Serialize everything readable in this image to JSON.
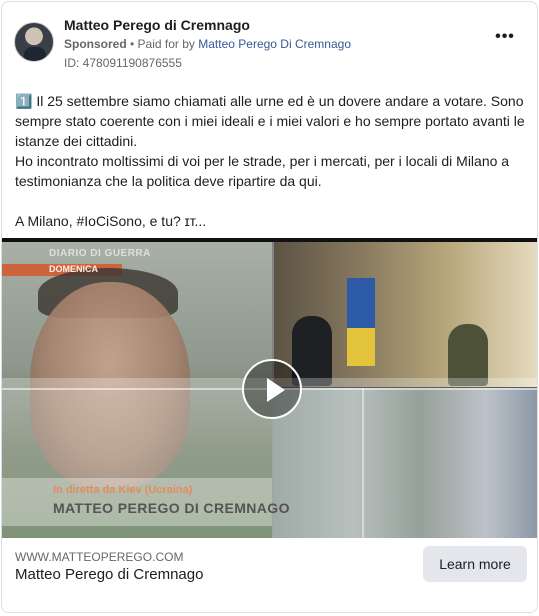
{
  "post": {
    "page_name": "Matteo Perego di Cremnago",
    "sponsored_label": "Sponsored",
    "separator": " • ",
    "paid_for_prefix": "Paid for by ",
    "paid_for_name": "Matteo Perego Di Cremnago",
    "ad_id": "ID: 478091190876555",
    "more_icon": "more-horizontal-icon",
    "more_label": "•••",
    "body_text": "1️⃣ Il 25 settembre siamo chiamati alle urne ed è un dovere andare a votare. Sono sempre stato coerente con i miei ideali e i miei valori e ho sempre portato avanti le istanze dei cittadini.\nHo incontrato moltissimi di voi per le strade, per i mercati, per i locali di Milano a testimonianza che la politica deve ripartire da qui.\n\nA Milano, #IoCiSono, e tu? ɪт..."
  },
  "video": {
    "overlay_title": "DIARIO DI GUERRA",
    "overlay_day": "DOMENICA",
    "location_caption": "In diretta da Kiev (Ucraina)",
    "name_caption": "MATTEO PEREGO DI CREMNAGO",
    "play_icon": "play-icon"
  },
  "footer": {
    "domain": "WWW.MATTEOPEREGO.COM",
    "title": "Matteo Perego di Cremnago",
    "cta_label": "Learn more"
  },
  "colors": {
    "link": "#385898",
    "secondary_text": "#65676b",
    "cta_bg": "#e4e6eb",
    "border": "#dadde1"
  }
}
